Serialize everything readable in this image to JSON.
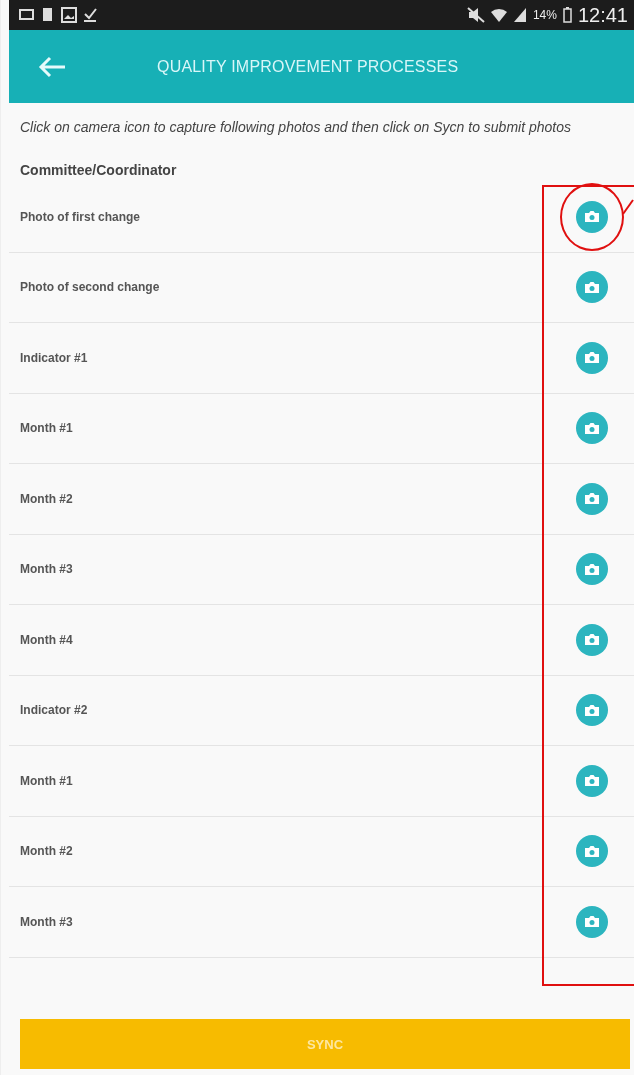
{
  "status_bar": {
    "battery": "14%",
    "time": "12:41"
  },
  "header": {
    "title": "QUALITY IMPROVEMENT PROCESSES"
  },
  "instruction": "Click on camera icon to capture following photos and then click on Sycn to submit photos",
  "section": {
    "title": "Committee/Coordinator"
  },
  "items": [
    {
      "label": "Photo of first change",
      "highlighted": true
    },
    {
      "label": "Photo of second change",
      "highlighted": false
    },
    {
      "label": "Indicator #1",
      "highlighted": false
    },
    {
      "label": "Month #1",
      "highlighted": false
    },
    {
      "label": "Month #2",
      "highlighted": false
    },
    {
      "label": "Month #3",
      "highlighted": false
    },
    {
      "label": "Month #4",
      "highlighted": false
    },
    {
      "label": "Indicator #2",
      "highlighted": false
    },
    {
      "label": "Month #1",
      "highlighted": false
    },
    {
      "label": "Month #2",
      "highlighted": false
    },
    {
      "label": "Month #3",
      "highlighted": false
    }
  ],
  "sync_button": {
    "label": "SYNC"
  }
}
